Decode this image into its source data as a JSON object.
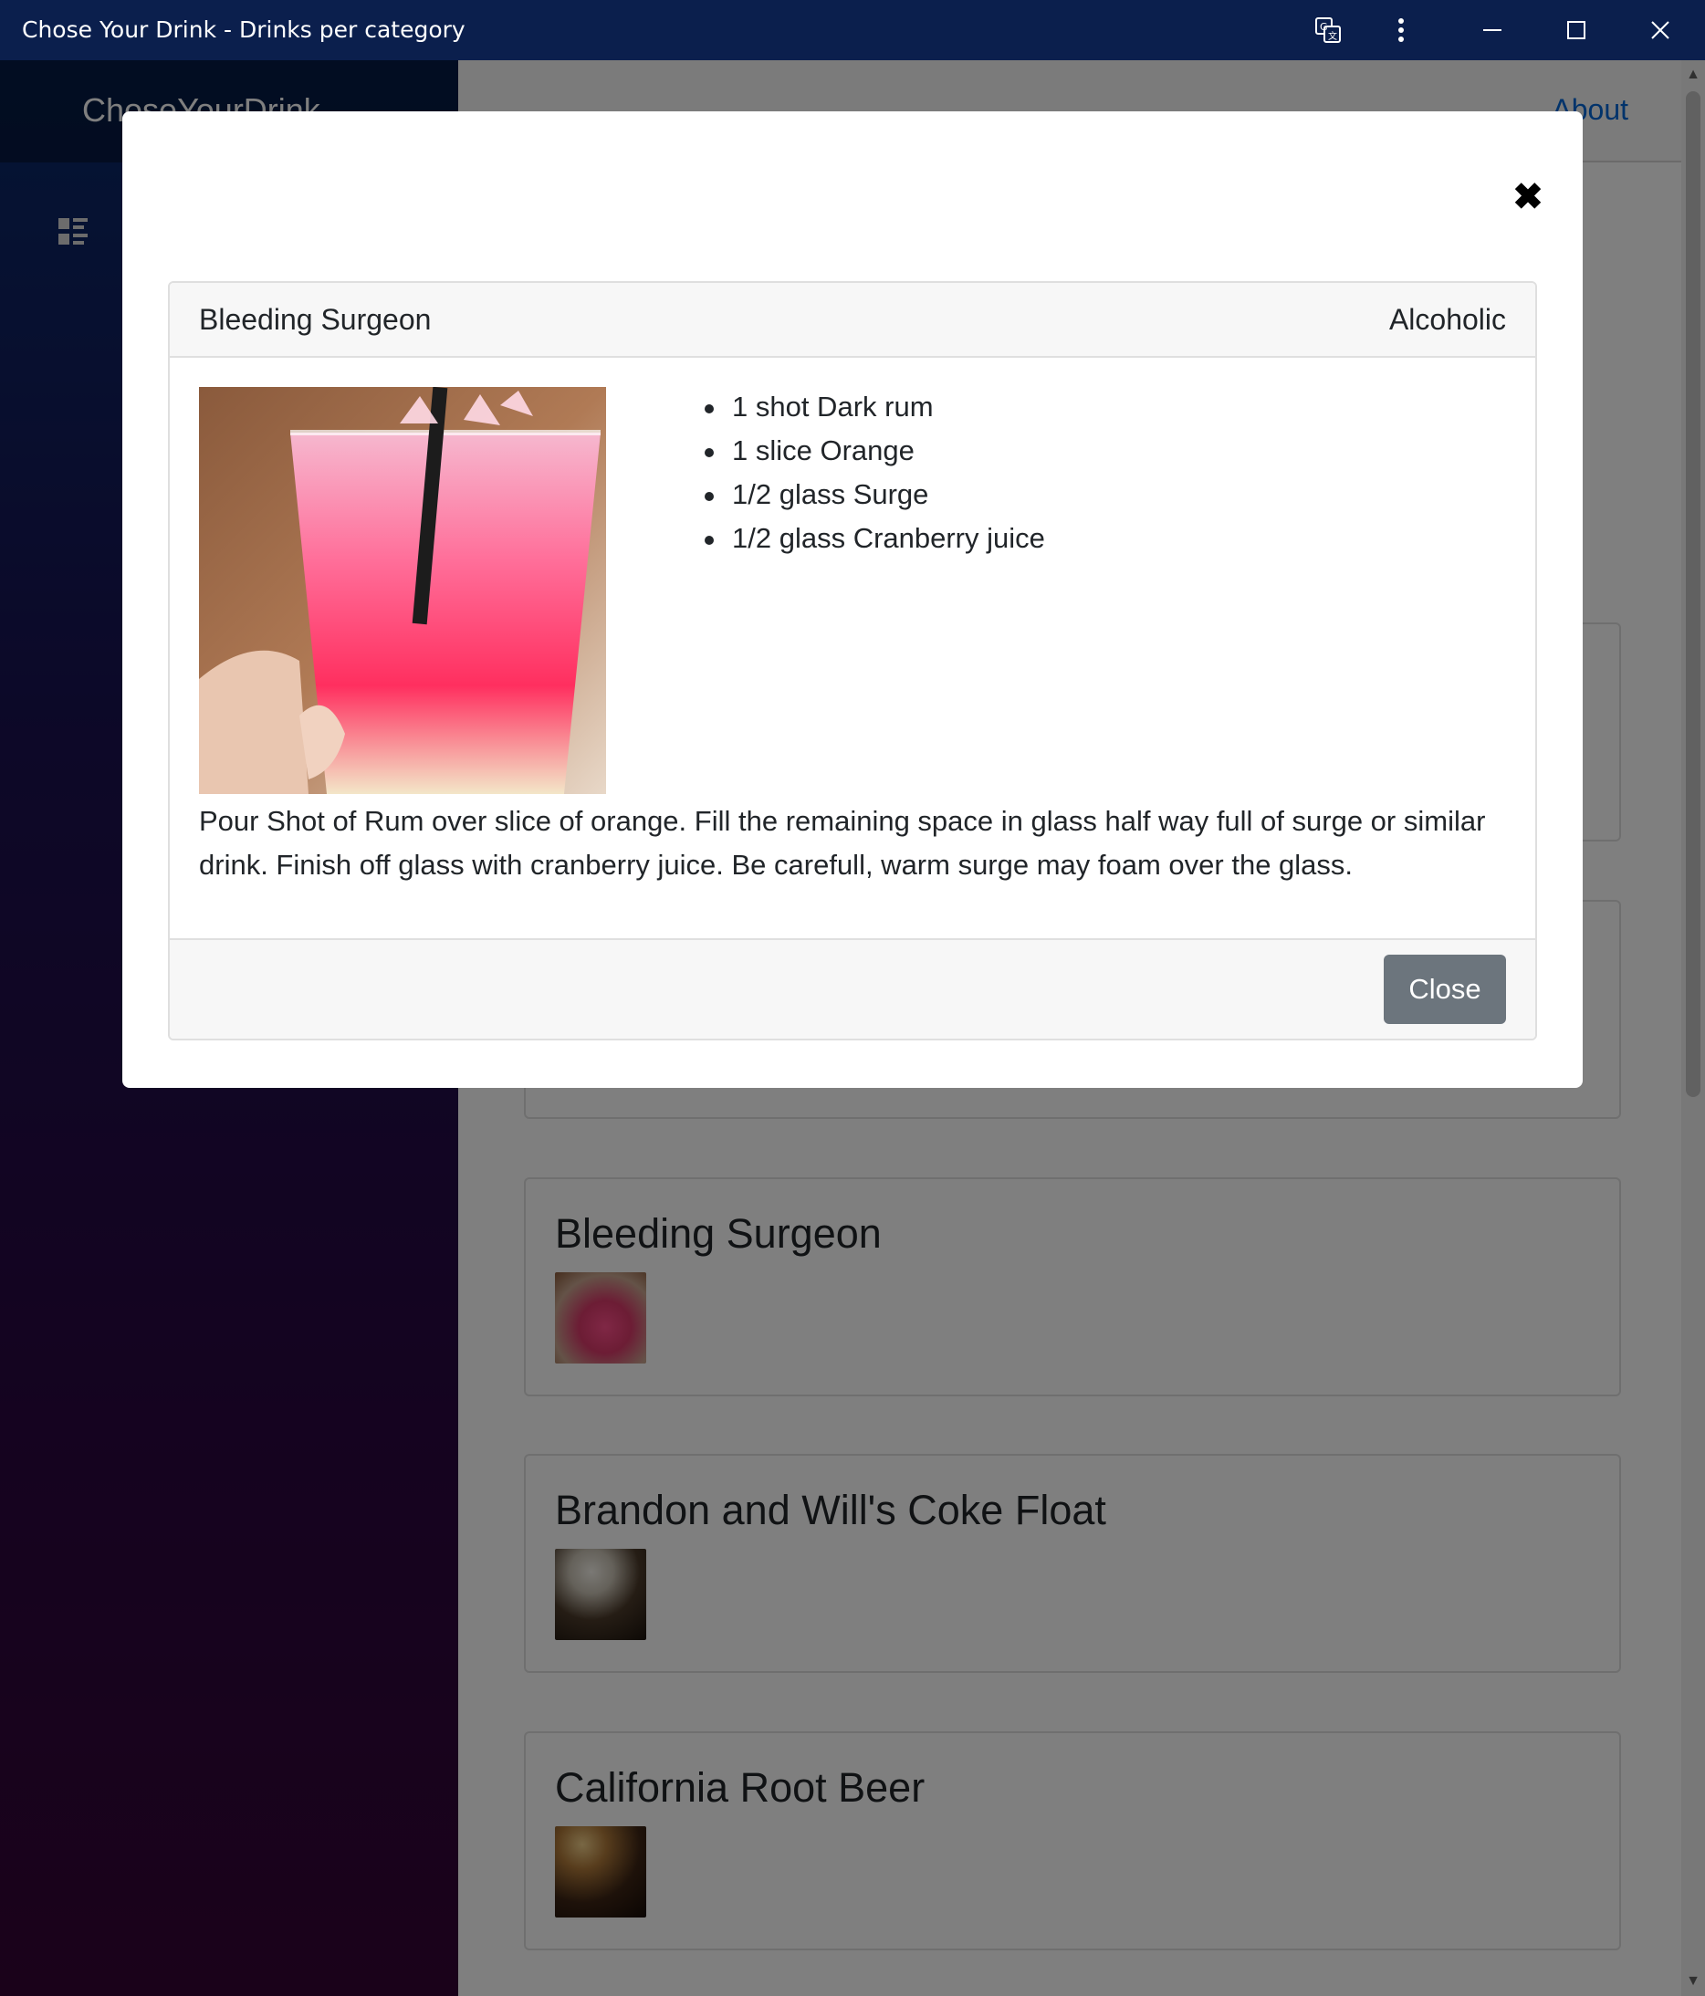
{
  "window": {
    "title": "Chose Your Drink - Drinks per category"
  },
  "sidebar": {
    "brand": "ChoseYourDrink",
    "nav_item_label": "",
    "nav_icon": "list-icon"
  },
  "topbar": {
    "about": "About"
  },
  "drink_cards": [
    {
      "name": "",
      "thumb": ""
    },
    {
      "name": "",
      "thumb": ""
    },
    {
      "name": "Bleeding Surgeon",
      "thumb": "pink-drink"
    },
    {
      "name": "Brandon and Will's Coke Float",
      "thumb": "coke-float"
    },
    {
      "name": "California Root Beer",
      "thumb": "root-beer"
    }
  ],
  "modal": {
    "close_icon": "close-icon",
    "drink": {
      "name": "Bleeding Surgeon",
      "category": "Alcoholic",
      "ingredients": [
        "1 shot Dark rum",
        "1 slice Orange",
        "1/2 glass Surge",
        "1/2 glass Cranberry juice"
      ],
      "instructions": "Pour Shot of Rum over slice of orange. Fill the remaining space in glass half way full of surge or similar drink. Finish off glass with cranberry juice. Be carefull, warm surge may foam over the glass."
    },
    "close_button": "Close"
  },
  "colors": {
    "titlebar": "#0b1f4d",
    "link": "#0366d6",
    "button_secondary": "#6c757d"
  }
}
